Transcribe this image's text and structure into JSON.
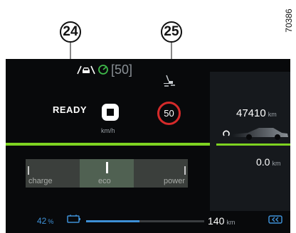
{
  "callouts": {
    "left_number": "24",
    "right_number": "25",
    "ref_code": "70386"
  },
  "adas": {
    "set_speed": "[50]",
    "car_icon": "adaptive-cruise-car-icon",
    "status_icon": "driver-assist-active-icon",
    "status_color": "#3fb84a"
  },
  "drive": {
    "ready": "READY",
    "speed_unit": "km/h",
    "speed_limit": "50"
  },
  "odometer": {
    "value": "47410",
    "unit": "km"
  },
  "trip": {
    "value": "0.0",
    "unit": "km"
  },
  "power_meter": {
    "labels": [
      "charge",
      "eco",
      "power"
    ],
    "needle_fraction": 0.5
  },
  "battery": {
    "percent": "42",
    "percent_symbol": "%",
    "range": "140",
    "range_unit": "km",
    "range_fraction": 0.45
  },
  "colors": {
    "accent_green": "#7ed321",
    "limit_red": "#d52a2a",
    "battery_blue": "#3e90d6"
  }
}
